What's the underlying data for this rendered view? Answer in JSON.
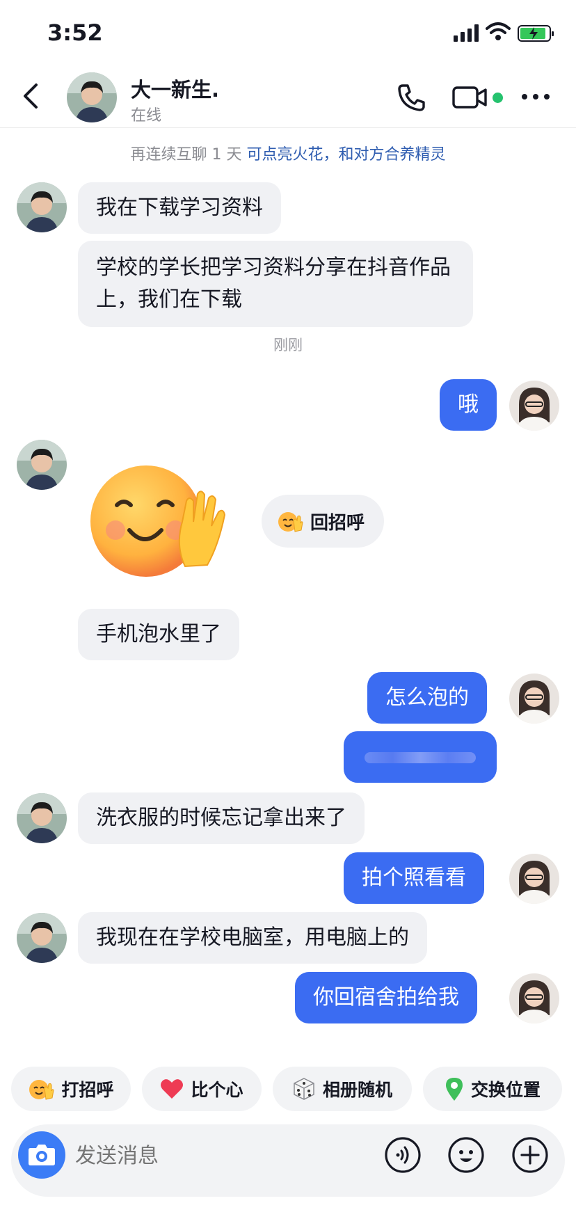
{
  "status_bar": {
    "time": "3:52"
  },
  "header": {
    "name": "大一新生.",
    "status": "在线",
    "online_color": "#25c26e"
  },
  "streak_notice": {
    "prefix": "再连续互聊 1 天 ",
    "highlight": "可点亮火花，和对方合养精灵"
  },
  "messages": {
    "m1": "我在下载学习资料",
    "m2": "学校的学长把学习资料分享在抖音作品上，我们在下载",
    "time1": "刚刚",
    "m3": "哦",
    "reply_chip": "回招呼",
    "m4": "手机泡水里了",
    "m5": "怎么泡的",
    "m7": "洗衣服的时候忘记拿出来了",
    "m8": "拍个照看看",
    "m9": "我现在在学校电脑室，用电脑上的",
    "m10": "你回宿舍拍给我"
  },
  "quick_actions": [
    {
      "label": "打招呼",
      "icon": "wave-emoji-icon"
    },
    {
      "label": "比个心",
      "icon": "heart-icon"
    },
    {
      "label": "相册随机",
      "icon": "dice-icon"
    },
    {
      "label": "交换位置",
      "icon": "location-pin-icon"
    }
  ],
  "input": {
    "placeholder": "发送消息"
  },
  "colors": {
    "accent": "#3b6cf2",
    "bubble_other": "#f0f1f4",
    "camera_button": "#3b7cf6"
  }
}
